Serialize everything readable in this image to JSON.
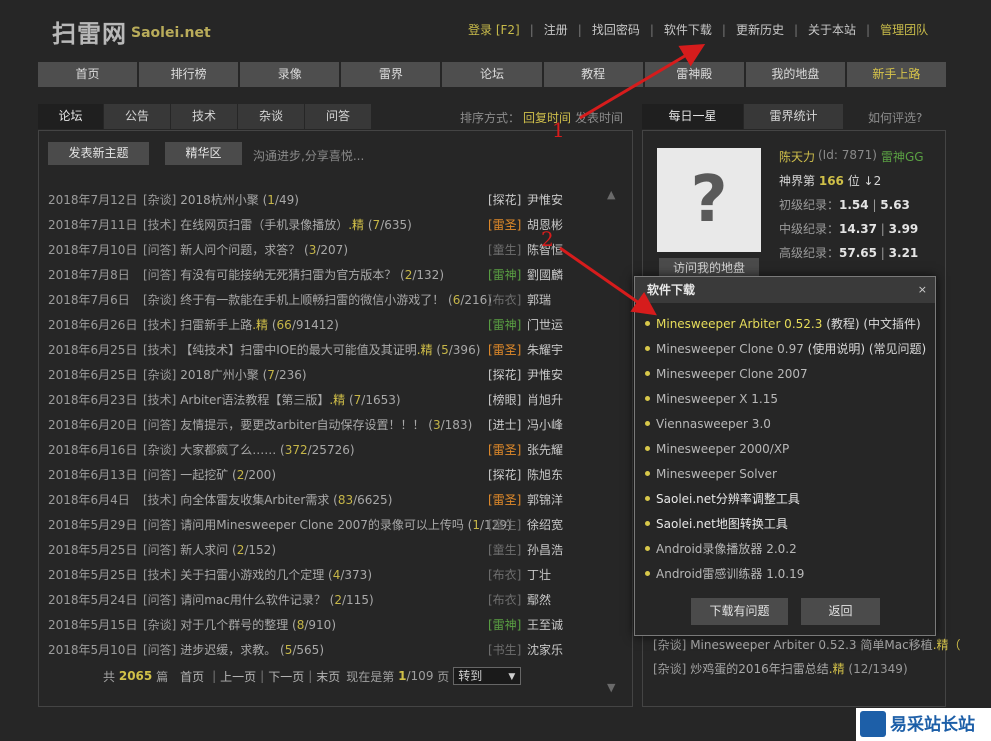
{
  "header": {
    "logo_cn": "扫雷网",
    "logo_en": "Saolei.net",
    "top_links": [
      {
        "label": "登录 [F2]",
        "accent": true
      },
      {
        "label": "注册",
        "accent": false
      },
      {
        "label": "找回密码",
        "accent": false
      },
      {
        "label": "软件下载",
        "accent": false
      },
      {
        "label": "更新历史",
        "accent": false
      },
      {
        "label": "关于本站",
        "accent": false
      },
      {
        "label": "管理团队",
        "accent": true
      }
    ],
    "separator": "|"
  },
  "main_nav": [
    {
      "label": "首页",
      "accent": false
    },
    {
      "label": "排行榜",
      "accent": false
    },
    {
      "label": "录像",
      "accent": false
    },
    {
      "label": "雷界",
      "accent": false
    },
    {
      "label": "论坛",
      "accent": false
    },
    {
      "label": "教程",
      "accent": false
    },
    {
      "label": "雷神殿",
      "accent": false
    },
    {
      "label": "我的地盘",
      "accent": false
    },
    {
      "label": "新手上路",
      "accent": true
    }
  ],
  "forum": {
    "tabs": [
      {
        "label": "论坛",
        "active": true
      },
      {
        "label": "公告",
        "active": false
      },
      {
        "label": "技术",
        "active": false
      },
      {
        "label": "杂谈",
        "active": false
      },
      {
        "label": "问答",
        "active": false
      }
    ],
    "sort_label": "排序方式：",
    "sort_active": "回复时间",
    "sort_other": "发表时间",
    "new_topic_button": "发表新主题",
    "best_button": "精华区",
    "slogan": "沟通进步,分享喜悦...",
    "scroll_up": "▲",
    "scroll_down": "▼",
    "posts": [
      {
        "date": "2018年7月12日",
        "cat": "[杂谈]",
        "title": "2018杭州小聚",
        "jing": "",
        "replies": "1",
        "views": "49",
        "rank": "[探花]",
        "rank_color": "#c9c9c9",
        "user": "尹惟安"
      },
      {
        "date": "2018年7月11日",
        "cat": "[技术]",
        "title": "在线网页扫雷（手机录像播放）",
        "jing": ".精",
        "replies": "7",
        "views": "635",
        "rank": "[雷圣]",
        "rank_color": "#e08a2a",
        "user": "胡恩彬"
      },
      {
        "date": "2018年7月10日",
        "cat": "[问答]",
        "title": "新人问个问题，求答？",
        "jing": "",
        "replies": "3",
        "views": "207",
        "rank": "[童生]",
        "rank_color": "#6e6e6e",
        "user": "陈智恒"
      },
      {
        "date": "2018年7月8日",
        "cat": "[问答]",
        "title": "有没有可能接纳无死猜扫雷为官方版本？",
        "jing": "",
        "replies": "2",
        "views": "132",
        "rank": "[雷神]",
        "rank_color": "#5aa043",
        "user": "劉國麟"
      },
      {
        "date": "2018年7月6日",
        "cat": "[杂谈]",
        "title": "终于有一款能在手机上顺畅扫雷的微信小游戏了！",
        "jing": "",
        "replies": "6",
        "views": "216",
        "rank": "[布衣]",
        "rank_color": "#6e6e6e",
        "user": "郭瑞"
      },
      {
        "date": "2018年6月26日",
        "cat": "[技术]",
        "title": "扫雷新手上路",
        "jing": ".精",
        "replies": "66",
        "views": "91412",
        "rank": "[雷神]",
        "rank_color": "#5aa043",
        "user": "门世运"
      },
      {
        "date": "2018年6月25日",
        "cat": "[技术]",
        "title": "【纯技术】扫雷中IOE的最大可能值及其证明",
        "jing": ".精",
        "replies": "5",
        "views": "396",
        "rank": "[雷圣]",
        "rank_color": "#e08a2a",
        "user": "朱耀宇"
      },
      {
        "date": "2018年6月25日",
        "cat": "[杂谈]",
        "title": "2018广州小聚",
        "jing": "",
        "replies": "7",
        "views": "236",
        "rank": "[探花]",
        "rank_color": "#c9c9c9",
        "user": "尹惟安"
      },
      {
        "date": "2018年6月23日",
        "cat": "[技术]",
        "title": "Arbiter语法教程【第三版】",
        "jing": ".精",
        "replies": "7",
        "views": "1653",
        "rank": "[榜眼]",
        "rank_color": "#c9c9c9",
        "user": "肖旭升"
      },
      {
        "date": "2018年6月20日",
        "cat": "[问答]",
        "title": "友情提示，要更改arbiter自动保存设置！！！",
        "jing": "",
        "replies": "3",
        "views": "183",
        "rank": "[进士]",
        "rank_color": "#c9c9c9",
        "user": "冯小峰"
      },
      {
        "date": "2018年6月16日",
        "cat": "[杂谈]",
        "title": "大家都疯了么……",
        "jing": "",
        "replies": "372",
        "views": "25726",
        "rank": "[雷圣]",
        "rank_color": "#e08a2a",
        "user": "张先耀"
      },
      {
        "date": "2018年6月13日",
        "cat": "[问答]",
        "title": "一起挖矿",
        "jing": "",
        "replies": "2",
        "views": "200",
        "rank": "[探花]",
        "rank_color": "#c9c9c9",
        "user": "陈旭东"
      },
      {
        "date": "2018年6月4日",
        "cat": "[技术]",
        "title": "向全体雷友收集Arbiter需求",
        "jing": "",
        "replies": "83",
        "views": "6625",
        "rank": "[雷圣]",
        "rank_color": "#e08a2a",
        "user": "郭锦洋"
      },
      {
        "date": "2018年5月29日",
        "cat": "[问答]",
        "title": "请问用Minesweeper Clone 2007的录像可以上传吗",
        "jing": "",
        "replies": "1",
        "views": "129",
        "rank": "[童生]",
        "rank_color": "#6e6e6e",
        "user": "徐绍宽"
      },
      {
        "date": "2018年5月25日",
        "cat": "[问答]",
        "title": "新人求问",
        "jing": "",
        "replies": "2",
        "views": "152",
        "rank": "[童生]",
        "rank_color": "#6e6e6e",
        "user": "孙昌浩"
      },
      {
        "date": "2018年5月25日",
        "cat": "[技术]",
        "title": "关于扫雷小游戏的几个定理",
        "jing": "",
        "replies": "4",
        "views": "373",
        "rank": "[布衣]",
        "rank_color": "#6e6e6e",
        "user": "丁壮"
      },
      {
        "date": "2018年5月24日",
        "cat": "[问答]",
        "title": "请问mac用什么软件记录？",
        "jing": "",
        "replies": "2",
        "views": "115",
        "rank": "[布衣]",
        "rank_color": "#6e6e6e",
        "user": "鄢然"
      },
      {
        "date": "2018年5月15日",
        "cat": "[杂谈]",
        "title": "对于几个群号的整理",
        "jing": "",
        "replies": "8",
        "views": "910",
        "rank": "[雷神]",
        "rank_color": "#5aa043",
        "user": "王至诚"
      },
      {
        "date": "2018年5月10日",
        "cat": "[问答]",
        "title": "进步迟缓，求教。",
        "jing": "",
        "replies": "5",
        "views": "565",
        "rank": "[书生]",
        "rank_color": "#6e6e6e",
        "user": "沈家乐"
      }
    ],
    "pager": {
      "total_prefix": "共",
      "total": "2065",
      "total_suffix": "篇",
      "first": "首页",
      "prev": "上一页",
      "next": "下一页",
      "last": "末页",
      "now_prefix": "现在是第",
      "now": "1",
      "of": "/109",
      "page_suffix": "页",
      "jump": "转到"
    }
  },
  "right": {
    "tabs": [
      {
        "label": "每日一星",
        "active": true
      },
      {
        "label": "雷界统计",
        "active": false
      }
    ],
    "eval_link": "如何评选?",
    "avatar_glyph": "?",
    "visit_button": "访问我的地盘",
    "star_name": "陈天力",
    "star_id": "(Id: 7871)",
    "star_title": "雷神GG",
    "rank_prefix": "神界第",
    "rank_num": "166",
    "rank_suffix": "位 ↓2",
    "records": [
      {
        "label": "初级纪录：",
        "a": "1.54",
        "b": "5.63"
      },
      {
        "label": "中级纪录：",
        "a": "14.37",
        "b": "3.99"
      },
      {
        "label": "高级纪录：",
        "a": "57.65",
        "b": "3.21"
      }
    ],
    "topic_a": {
      "cat": "[杂谈]",
      "title": "Minesweeper Arbiter 0.52.3 简单Mac移植",
      "tail": ".精（"
    },
    "topic_b": {
      "cat": "[杂谈]",
      "title": "炒鸡蛋的2016年扫雷总结",
      "jing": ".精",
      "counts": "(12/1349)"
    }
  },
  "dialog": {
    "title": "软件下载",
    "close": "×",
    "items": [
      {
        "name": "Minesweeper Arbiter 0.52.3",
        "extra": "(教程) (中文插件)",
        "highlight": true,
        "white": false
      },
      {
        "name": "Minesweeper Clone 0.97",
        "extra": "(使用说明) (常见问题)",
        "highlight": false,
        "white": false
      },
      {
        "name": "Minesweeper Clone 2007",
        "extra": "",
        "highlight": false,
        "white": false
      },
      {
        "name": "Minesweeper X 1.15",
        "extra": "",
        "highlight": false,
        "white": false
      },
      {
        "name": "Viennasweeper 3.0",
        "extra": "",
        "highlight": false,
        "white": false
      },
      {
        "name": "Minesweeper 2000/XP",
        "extra": "",
        "highlight": false,
        "white": false
      },
      {
        "name": "Minesweeper Solver",
        "extra": "",
        "highlight": false,
        "white": false
      },
      {
        "name": "Saolei.net分辨率调整工具",
        "extra": "",
        "highlight": false,
        "white": true
      },
      {
        "name": "Saolei.net地图转换工具",
        "extra": "",
        "highlight": false,
        "white": true
      },
      {
        "name": "Android录像播放器 2.0.2",
        "extra": "",
        "highlight": false,
        "white": false
      },
      {
        "name": "Android雷感训练器 1.0.19",
        "extra": "",
        "highlight": false,
        "white": false
      }
    ],
    "problem_button": "下载有问题",
    "back_button": "返回"
  },
  "annotations": {
    "num1": "1",
    "num2": "2",
    "color": "#d61c1c"
  },
  "watermark": {
    "text": "易采站长站"
  }
}
